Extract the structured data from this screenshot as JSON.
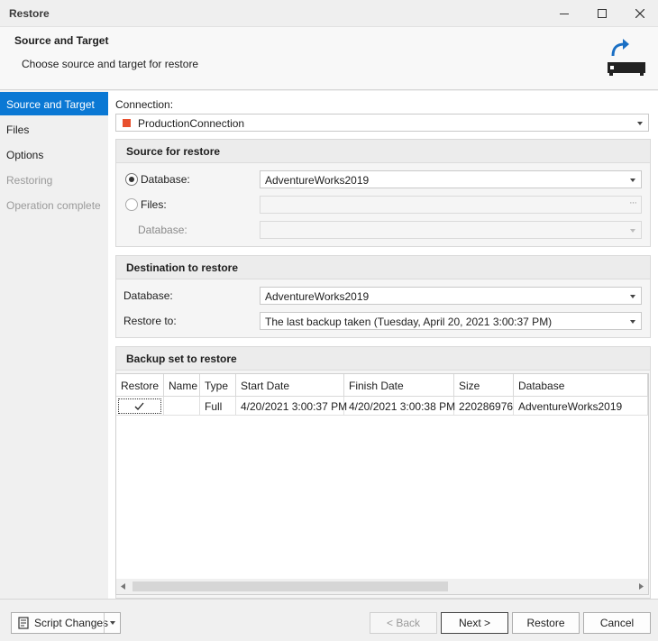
{
  "window": {
    "title": "Restore"
  },
  "header": {
    "title": "Source and Target",
    "subtitle": "Choose source and target for restore"
  },
  "sidebar": {
    "items": [
      {
        "label": "Source and Target",
        "state": "active"
      },
      {
        "label": "Files",
        "state": "enabled"
      },
      {
        "label": "Options",
        "state": "enabled"
      },
      {
        "label": "Restoring",
        "state": "disabled"
      },
      {
        "label": "Operation complete",
        "state": "disabled"
      }
    ]
  },
  "connection": {
    "label": "Connection:",
    "value": "ProductionConnection",
    "color": "#e8502e"
  },
  "source": {
    "heading": "Source for restore",
    "database_option": "Database:",
    "database_value": "AdventureWorks2019",
    "files_option": "Files:",
    "files_value": "",
    "files_database_label": "Database:",
    "files_database_value": "",
    "selected": "database"
  },
  "destination": {
    "heading": "Destination to restore",
    "database_label": "Database:",
    "database_value": "AdventureWorks2019",
    "restore_to_label": "Restore to:",
    "restore_to_value": "The last backup taken (Tuesday, April 20, 2021 3:00:37 PM)"
  },
  "backup_set": {
    "heading": "Backup set to restore",
    "columns": [
      "Restore",
      "Name",
      "Type",
      "Start Date",
      "Finish Date",
      "Size",
      "Database"
    ],
    "rows": [
      {
        "restore": true,
        "name": "",
        "type": "Full",
        "start_date": "4/20/2021 3:00:37 PM",
        "finish_date": "4/20/2021 3:00:38 PM",
        "size": "220286976",
        "database": "AdventureWorks2019"
      }
    ]
  },
  "footer": {
    "script_changes": "Script Changes",
    "back": "< Back",
    "next": "Next >",
    "restore": "Restore",
    "cancel": "Cancel"
  },
  "icons": {
    "minimize": "minimize-icon",
    "maximize": "maximize-icon",
    "close": "close-icon",
    "header": "restore-database-icon",
    "check": "check-icon",
    "script": "script-icon"
  }
}
